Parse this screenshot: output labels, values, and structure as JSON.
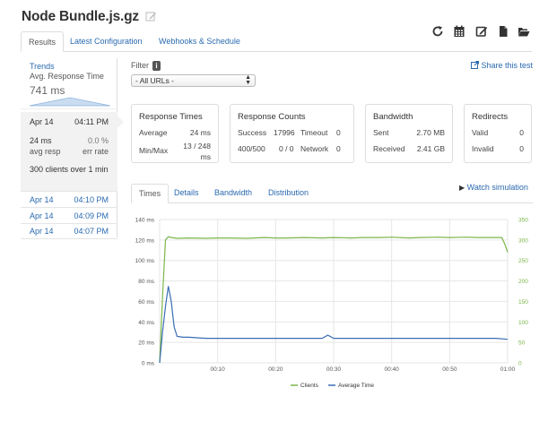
{
  "header": {
    "title": "Node Bundle.js.gz",
    "toolbar_icons": [
      "refresh-icon",
      "calendar-icon",
      "edit-icon",
      "document-icon",
      "folder-icon"
    ]
  },
  "tabs": [
    {
      "label": "Results",
      "active": true
    },
    {
      "label": "Latest Configuration",
      "active": false
    },
    {
      "label": "Webhooks & Schedule",
      "active": false
    }
  ],
  "trends": {
    "link": "Trends",
    "avg_label": "Avg. Response Time",
    "avg_value": "741 ms"
  },
  "selected_run": {
    "date": "Apr 14",
    "time": "04:11 PM",
    "avg_resp_value": "24 ms",
    "avg_resp_label": "avg resp",
    "err_rate_value": "0.0 %",
    "err_rate_label": "err rate",
    "clients_text": "300 clients over 1 min"
  },
  "other_runs": [
    {
      "date": "Apr 14",
      "time": "04:10 PM"
    },
    {
      "date": "Apr 14",
      "time": "04:09 PM"
    },
    {
      "date": "Apr 14",
      "time": "04:07 PM"
    }
  ],
  "filter": {
    "label": "Filter",
    "info": "i",
    "selected": "- All URLs -"
  },
  "share_link": "Share this test",
  "stats": {
    "response_times": {
      "title": "Response Times",
      "average_label": "Average",
      "average_value": "24 ms",
      "minmax_label": "Min/Max",
      "minmax_value": "13 / 248 ms"
    },
    "response_counts": {
      "title": "Response Counts",
      "success_label": "Success",
      "success_value": "17996",
      "timeout_label": "Timeout",
      "timeout_value": "0",
      "c400_label": "400/500",
      "c400_value": "0 / 0",
      "network_label": "Network",
      "network_value": "0"
    },
    "bandwidth": {
      "title": "Bandwidth",
      "sent_label": "Sent",
      "sent_value": "2.70 MB",
      "received_label": "Received",
      "received_value": "2.41 GB"
    },
    "redirects": {
      "title": "Redirects",
      "valid_label": "Valid",
      "valid_value": "0",
      "invalid_label": "Invalid",
      "invalid_value": "0"
    }
  },
  "chart_tabs": [
    {
      "label": "Times",
      "active": true
    },
    {
      "label": "Details",
      "active": false
    },
    {
      "label": "Bandwidth",
      "active": false
    },
    {
      "label": "Distribution",
      "active": false
    }
  ],
  "watch_simulation": "Watch simulation",
  "colors": {
    "link": "#2a6ab0",
    "clients": "#7ab648",
    "avg_time": "#3a6db5"
  },
  "chart_data": {
    "type": "line",
    "left_axis": {
      "ticks": [
        "0 ms",
        "20 ms",
        "40 ms",
        "60 ms",
        "80 ms",
        "100 ms",
        "120 ms",
        "140 ms"
      ],
      "values": [
        0,
        20,
        40,
        60,
        80,
        100,
        120,
        140
      ],
      "ylim": [
        0,
        140
      ],
      "color": "#3a6db5"
    },
    "right_axis": {
      "ticks": [
        "0",
        "50",
        "100",
        "150",
        "200",
        "250",
        "300",
        "350"
      ],
      "values": [
        0,
        50,
        100,
        150,
        200,
        250,
        300,
        350
      ],
      "ylim": [
        0,
        350
      ],
      "color": "#7ab648"
    },
    "x_axis": {
      "ticks": [
        "00:10",
        "00:20",
        "00:30",
        "00:40",
        "00:50",
        "01:00"
      ],
      "values": [
        10,
        20,
        30,
        40,
        50,
        60
      ],
      "xlim": [
        0,
        60
      ]
    },
    "grid": true,
    "legend_position": "bottom-center",
    "series": [
      {
        "name": "Clients",
        "axis": "right",
        "color": "#7ab648",
        "x": [
          0,
          0.5,
          1,
          1.5,
          2,
          3,
          5,
          8,
          10,
          12,
          15,
          18,
          20,
          22,
          25,
          28,
          30,
          33,
          35,
          38,
          40,
          43,
          45,
          48,
          50,
          53,
          55,
          57,
          59,
          59.5,
          60
        ],
        "y": [
          0,
          160,
          300,
          308,
          306,
          304,
          305,
          304,
          305,
          305,
          304,
          306,
          305,
          305,
          306,
          305,
          306,
          305,
          306,
          306,
          307,
          305,
          306,
          307,
          306,
          307,
          306,
          306,
          306,
          290,
          270
        ]
      },
      {
        "name": "Average Time",
        "axis": "left",
        "color": "#3a6db5",
        "x": [
          0,
          0.5,
          1,
          1.5,
          2,
          2.5,
          3,
          4,
          5,
          8,
          10,
          12,
          15,
          18,
          20,
          22,
          25,
          28,
          29,
          30,
          33,
          35,
          38,
          40,
          43,
          45,
          48,
          50,
          53,
          55,
          58,
          60
        ],
        "y": [
          0,
          30,
          55,
          75,
          60,
          35,
          26,
          25,
          25,
          24,
          24,
          24,
          24,
          24,
          24,
          24,
          24,
          24,
          27,
          24,
          24,
          24,
          24,
          24,
          24,
          24,
          24,
          24,
          24,
          24,
          24,
          23
        ]
      }
    ]
  }
}
